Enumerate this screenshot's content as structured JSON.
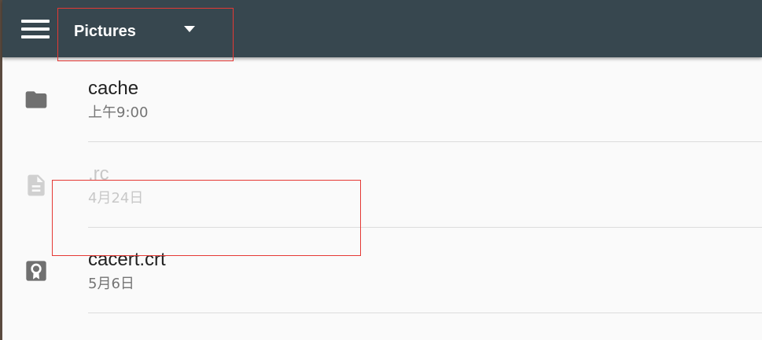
{
  "toolbar": {
    "menu_icon": "hamburger-menu-icon",
    "directory_title": "Pictures",
    "dropdown_icon": "dropdown-arrow-icon",
    "background_color": "#37474f"
  },
  "files": [
    {
      "name": "cache",
      "meta": "上午9:00",
      "icon": "folder-icon",
      "enabled": true
    },
    {
      "name": ".rc",
      "meta": "4月24日",
      "icon": "document-icon",
      "enabled": false
    },
    {
      "name": "cacert.crt",
      "meta": "5月6日",
      "icon": "certificate-icon",
      "enabled": true
    }
  ],
  "colors": {
    "highlight_outline": "#e53935",
    "icon_gray": "#707070",
    "disabled_gray": "#d0d0d0"
  }
}
